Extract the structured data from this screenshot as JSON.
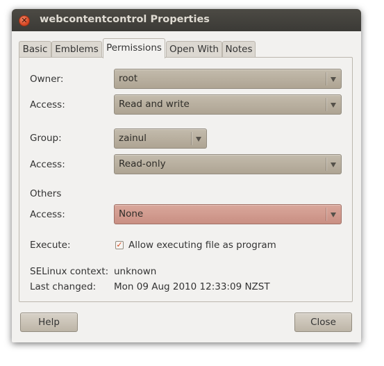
{
  "window": {
    "title": "webcontentcontrol Properties",
    "close_glyph": "✕"
  },
  "tabs": [
    {
      "label": "Basic"
    },
    {
      "label": "Emblems"
    },
    {
      "label": "Permissions"
    },
    {
      "label": "Open With"
    },
    {
      "label": "Notes"
    }
  ],
  "active_tab": "Permissions",
  "permissions": {
    "owner": {
      "label": "Owner:",
      "value": "root"
    },
    "owner_access": {
      "label": "Access:",
      "value": "Read and write"
    },
    "group": {
      "label": "Group:",
      "value": "zainul"
    },
    "group_access": {
      "label": "Access:",
      "value": "Read-only"
    },
    "others": {
      "heading": "Others",
      "label": "Access:",
      "value": "None"
    },
    "execute": {
      "label": "Execute:",
      "checkbox_label": "Allow executing file as program",
      "checked": true
    },
    "selinux": {
      "label": "SELinux context:",
      "value": "unknown"
    },
    "last_changed": {
      "label": "Last changed:",
      "value": "Mon 09 Aug 2010 12:33:09 NZST"
    }
  },
  "buttons": {
    "help": "Help",
    "close": "Close"
  },
  "icons": [
    "close-icon",
    "dropdown-arrow-icon",
    "checkmark-icon"
  ],
  "colors": {
    "titlebar": "#3f3d39",
    "combo": "#b9b0a0",
    "combo_warning": "#d19a8e",
    "check": "#d34a1e"
  }
}
